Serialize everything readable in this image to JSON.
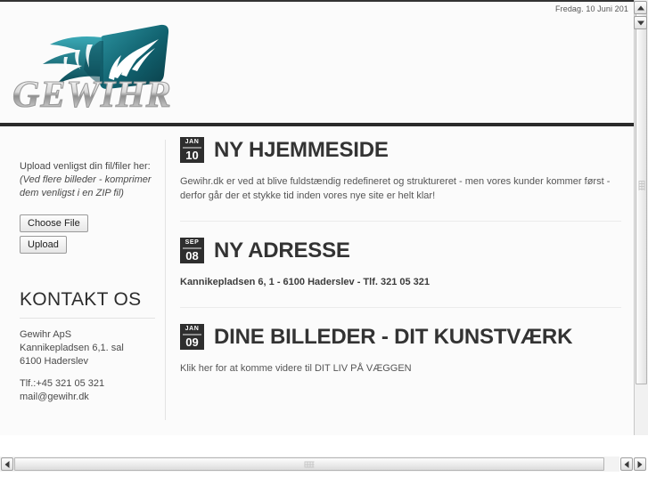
{
  "window": {
    "date_line": "Fredag. 10 Juni 201"
  },
  "header": {
    "logo_text": "GEWIHR",
    "logo_icon": "feather-wing-logo",
    "logo_colors": {
      "teal_dark": "#0d5560",
      "teal_mid": "#177a86",
      "teal_light": "#2fa0ac",
      "white": "#ffffff"
    }
  },
  "sidebar": {
    "upload_line1": "Upload venligst din fil/filer her:",
    "upload_note": "(Ved flere billeder - komprimer dem venligst i en ZIP fil)",
    "choose_file_label": "Choose File",
    "upload_label": "Upload",
    "kontakt_title": "KONTAKT OS",
    "company": "Gewihr ApS",
    "address1": "Kannikepladsen 6,1. sal",
    "address2": "6100 Haderslev",
    "phone": "Tlf.:+45 321 05 321",
    "email": "mail@gewihr.dk"
  },
  "posts": [
    {
      "month": "JAN",
      "day": "10",
      "title": "NY HJEMMESIDE",
      "body": "Gewihr.dk er ved at blive fuldstændig redefineret og struktureret - men vores kunder kommer først - derfor går der et stykke tid inden vores nye site er helt klar!",
      "bold": false
    },
    {
      "month": "SEP",
      "day": "08",
      "title": "NY ADRESSE",
      "body": "Kannikepladsen 6, 1 - 6100 Haderslev - Tlf. 321 05 321",
      "bold": true
    },
    {
      "month": "JAN",
      "day": "09",
      "title": "DINE BILLEDER - DIT KUNSTVÆRK",
      "body": "Klik her for at komme videre til DIT LIV PÅ VÆGGEN",
      "bold": false
    }
  ],
  "scrollbars": {
    "vertical_up_icon": "arrow-up-icon",
    "vertical_down_icon": "arrow-down-icon",
    "horizontal_left_icon": "arrow-left-icon",
    "horizontal_right_icon": "arrow-right-icon"
  }
}
